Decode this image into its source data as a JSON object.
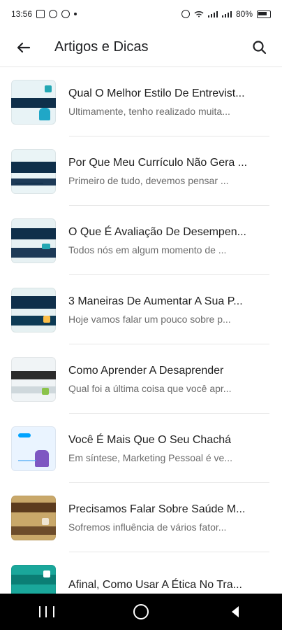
{
  "status_bar": {
    "time": "13:56",
    "battery_text": "80%",
    "icons": [
      "gallery-icon",
      "messenger-icon",
      "settings-icon",
      "dot-icon",
      "alarm-icon",
      "wifi-icon",
      "signal-icon",
      "signal-icon",
      "battery-icon"
    ]
  },
  "app_bar": {
    "title": "Artigos e Dicas",
    "back_icon": "arrow-left-icon",
    "search_icon": "search-icon"
  },
  "articles": [
    {
      "title": "Qual O Melhor Estilo De Entrevist...",
      "excerpt": "Ultimamente, tenho realizado muita..."
    },
    {
      "title": "Por Que Meu Currículo Não Gera ...",
      "excerpt": "Primeiro de tudo, devemos pensar ..."
    },
    {
      "title": "O Que É Avaliação De Desempen...",
      "excerpt": "Todos nós em algum momento de ..."
    },
    {
      "title": "3 Maneiras De Aumentar A Sua P...",
      "excerpt": "Hoje vamos falar um pouco sobre p..."
    },
    {
      "title": "Como Aprender A Desaprender",
      "excerpt": "Qual foi a última coisa que você apr..."
    },
    {
      "title": "Você É Mais Que O Seu Chachá",
      "excerpt": "Em síntese, Marketing Pessoal é ve..."
    },
    {
      "title": "Precisamos Falar Sobre Saúde M...",
      "excerpt": "Sofremos influência de vários fator..."
    },
    {
      "title": "Afinal, Como Usar A Ética No Tra...",
      "excerpt": ""
    }
  ],
  "navigation": {
    "recents_icon": "recents-icon",
    "home_icon": "home-icon",
    "back_icon": "back-icon"
  },
  "colors": {
    "primary_dark": "#0f2f4a",
    "accent_teal": "#23a7b3"
  }
}
